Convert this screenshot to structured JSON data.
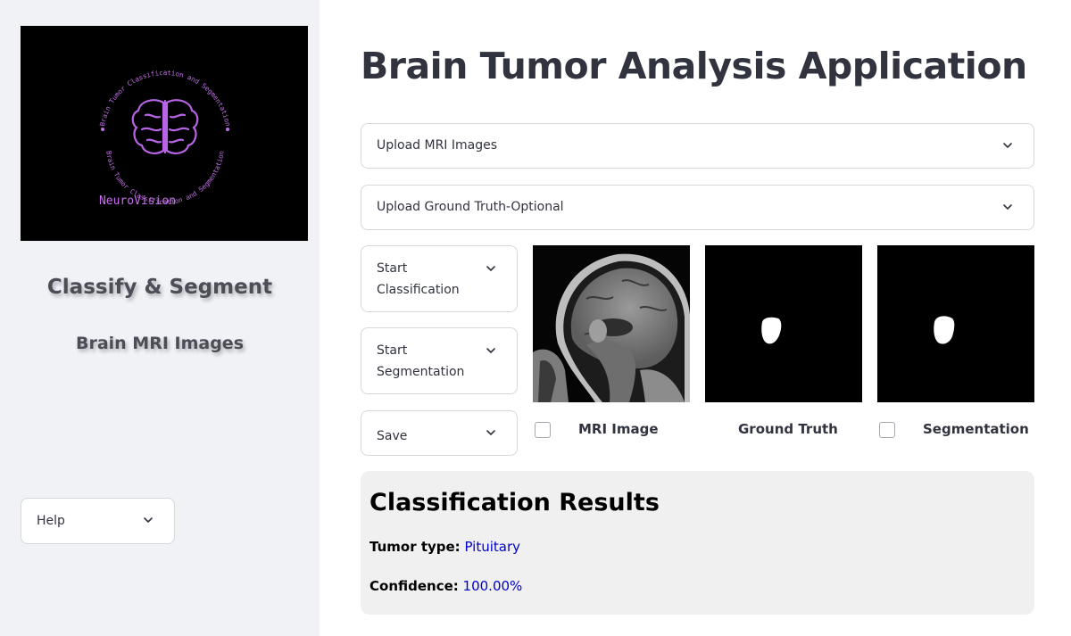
{
  "sidebar": {
    "logo": {
      "arc_text_top": "Brain Tumor Classification and Segmentation",
      "arc_text_bottom": "Brain Tumor Classification and Segmentation",
      "brand": "NeuroVision",
      "icon": "brain-icon"
    },
    "title": "Classify & Segment",
    "subtitle": "Brain MRI Images",
    "help_label": "Help"
  },
  "main": {
    "title": "Brain Tumor Analysis Application",
    "upload_mri_label": "Upload MRI Images",
    "upload_gt_label": "Upload Ground Truth-Optional",
    "actions": {
      "start_classification_line1": "Start",
      "start_classification_line2": "Classification",
      "start_segmentation_line1": "Start",
      "start_segmentation_line2": "Segmentation",
      "save_label": "Save"
    },
    "images": {
      "mri_caption": "MRI Image",
      "gt_caption": "Ground Truth",
      "seg_caption": "Segmentation"
    },
    "results": {
      "heading": "Classification Results",
      "tumor_type_label": "Tumor type:",
      "tumor_type_value": "Pituitary",
      "confidence_label": "Confidence:",
      "confidence_value": "100.00%"
    }
  },
  "colors": {
    "sidebar_bg": "#f0f2f6",
    "accent_text": "#0000cc",
    "logo_purple": "#b060e0",
    "results_bg": "#f0f0f0"
  }
}
